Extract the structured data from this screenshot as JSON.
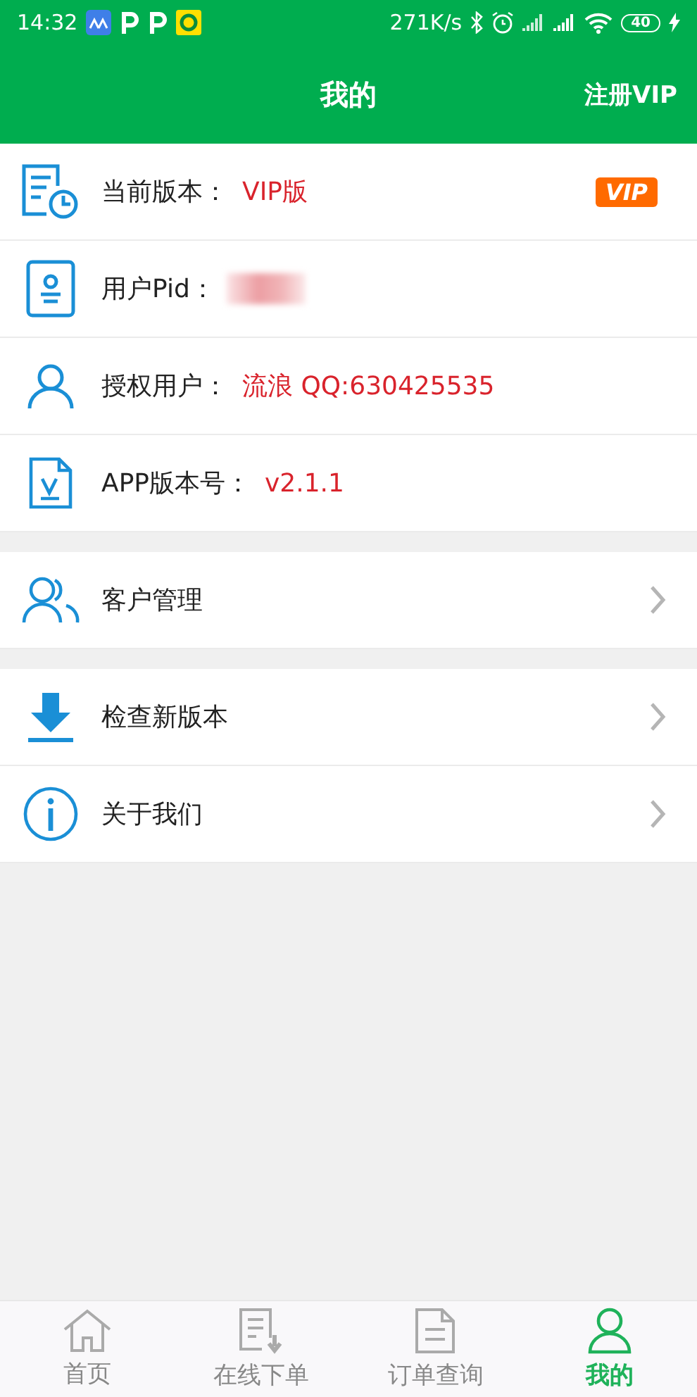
{
  "status_bar": {
    "time": "14:32",
    "speed": "271K/s",
    "battery": "40"
  },
  "header": {
    "title": "我的",
    "action": "注册VIP"
  },
  "info_rows": [
    {
      "label": "当前版本：",
      "value": "VIP版",
      "badge": "VIP",
      "masked": false
    },
    {
      "label": "用户Pid：",
      "value": "",
      "masked": true
    },
    {
      "label": "授权用户：",
      "value": "流浪 QQ:630425535",
      "masked": false
    },
    {
      "label": "APP版本号：",
      "value": "v2.1.1",
      "masked": false
    }
  ],
  "menu_groups": [
    [
      {
        "label": "客户管理"
      }
    ],
    [
      {
        "label": "检查新版本"
      },
      {
        "label": "关于我们"
      }
    ]
  ],
  "tab_bar": [
    {
      "label": "首页",
      "selected": false
    },
    {
      "label": "在线下单",
      "selected": false
    },
    {
      "label": "订单查询",
      "selected": false
    },
    {
      "label": "我的",
      "selected": true
    }
  ]
}
